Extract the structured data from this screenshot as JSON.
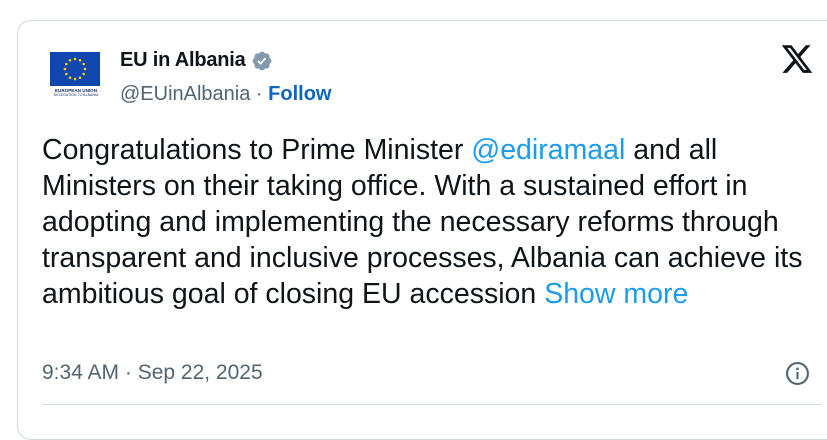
{
  "account": {
    "display_name": "EU in Albania",
    "handle": "@EUinAlbania",
    "separator": " · ",
    "follow_label": "Follow",
    "verified": true,
    "avatar": {
      "caption_main": "EUROPEAN UNION",
      "caption_sub": "DELEGATION TO ALBANIA",
      "flag_color": "#0f47af",
      "star_color": "#ffcc00"
    }
  },
  "tweet": {
    "text_before": "Congratulations to Prime Minister ",
    "mention": "@ediramaal",
    "text_after": " and all Ministers on their taking office. With a sustained effort in adopting and implementing the necessary reforms through transparent and inclusive processes, Albania can achieve its ambitious goal of closing EU accession ",
    "show_more_label": "Show more"
  },
  "meta": {
    "timestamp": "9:34 AM · Sep 22, 2025"
  },
  "icons": {
    "platform_logo": "x-logo-icon",
    "verified_badge": "verified-badge-icon",
    "info": "info-icon"
  },
  "colors": {
    "link": "#1d9bf0",
    "follow": "#0a66c2",
    "text": "#0f1419",
    "secondary": "#536471",
    "border": "#cfd9de"
  }
}
